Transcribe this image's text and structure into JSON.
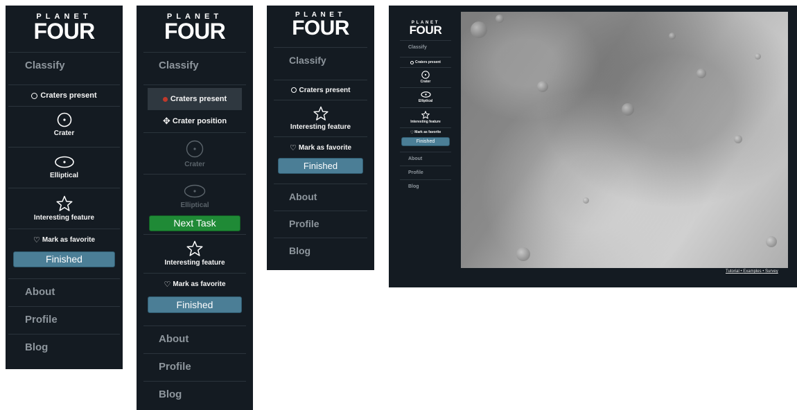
{
  "brand": {
    "top": "PLANET",
    "main": "FOUR"
  },
  "nav": {
    "classify": "Classify",
    "about": "About",
    "profile": "Profile",
    "blog": "Blog"
  },
  "tools": {
    "craters_present": "Craters present",
    "crater_position": "Crater position",
    "crater": "Crater",
    "elliptical": "Elliptical",
    "interesting": "Interesting feature",
    "favorite": "Mark as favorite",
    "finished": "Finished",
    "next_task": "Next Task"
  },
  "footer": {
    "tutorial": "Tutorial",
    "sep": "•",
    "examples": "Examples",
    "survey": "Survey"
  },
  "colors": {
    "panel_bg": "#141b22",
    "finished_button": "#4b7e96",
    "next_button": "#1f8a36",
    "craters_present_dot": "#c0392b"
  },
  "icons": {
    "craters_present": "circle-outline-icon",
    "crater_position": "crosshair-move-icon",
    "crater": "circle-dot-icon",
    "elliptical": "ellipse-dot-icon",
    "interesting": "star-outline-icon",
    "favorite": "heart-outline-icon"
  }
}
